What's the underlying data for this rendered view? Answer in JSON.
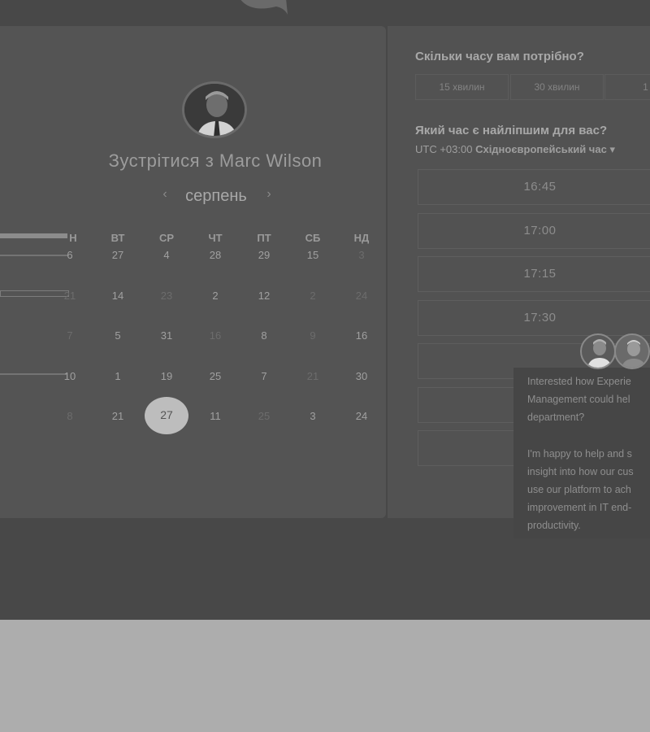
{
  "booking": {
    "meet_title_prefix": "Зустрітися з ",
    "host_name": "Marc Wilson",
    "month": "серпень",
    "prev_icon": "chevron-left-icon",
    "next_icon": "chevron-right-icon"
  },
  "calendar": {
    "weekday_headers": [
      "ВТ",
      "СР",
      "ЧТ",
      "ПТ",
      "СБ",
      "НД"
    ],
    "partial_header": "Н",
    "rows": [
      [
        "6",
        "27",
        "4",
        "28",
        "29",
        "15",
        "3"
      ],
      [
        "21",
        "14",
        "23",
        "2",
        "12",
        "2",
        "24"
      ],
      [
        "7",
        "5",
        "31",
        "16",
        "8",
        "9",
        "16"
      ],
      [
        "10",
        "1",
        "19",
        "25",
        "7",
        "21",
        "30"
      ],
      [
        "8",
        "21",
        "27",
        "11",
        "25",
        "3",
        "24"
      ]
    ],
    "selected_day": "27"
  },
  "duration": {
    "question": "Скільки часу вам потрібно?",
    "options": [
      "15 хвилин",
      "30 хвилин",
      "1 го"
    ]
  },
  "time": {
    "question": "Який час є найліпшим для вас?",
    "timezone_offset": "UTC +03:00",
    "timezone_name": "Східноєвропейський час",
    "timezone_arrow": "▾",
    "slots": [
      "16:45",
      "17:00",
      "17:15",
      "17:30",
      "",
      "",
      ""
    ]
  },
  "chat": {
    "lines_1": [
      "Interested how Experie",
      "Management could hel",
      "department?"
    ],
    "lines_2": [
      "I'm happy to help and s",
      "insight into how our cus",
      "use our platform to ach",
      "improvement in IT end-",
      "productivity."
    ]
  },
  "colors": {
    "page_background": "#adadad",
    "stage_background": "#484848",
    "card_background": "#545454",
    "selected_day": "#bdbdbd"
  }
}
